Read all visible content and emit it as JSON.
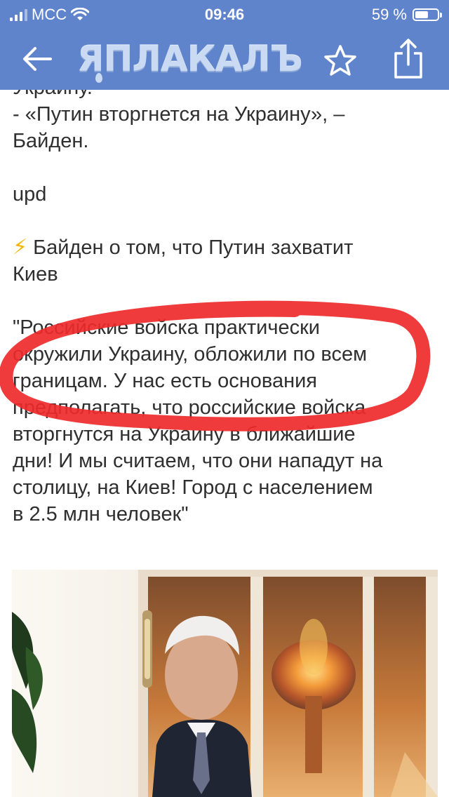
{
  "status_bar": {
    "carrier": "MCC",
    "time": "09:46",
    "battery_percent": "59 %",
    "battery_level": 0.59
  },
  "nav": {
    "logo_text": "ЯПЛАКАЛЪ",
    "back_icon": "arrow-left-icon",
    "star_icon": "star-icon",
    "share_icon": "share-icon",
    "bar_color": "#5f84cb"
  },
  "article": {
    "lines": [
      "Украину.",
      "- «Путин вторгнется на Украину», –",
      "Байден.",
      "",
      "upd",
      "",
      "Байден о том, что Путин захватит",
      "Киев",
      "",
      "\"Российские войска практически",
      "окружили Украину, обложили по всем",
      "границам. У нас есть основания",
      "предполагать, что российские войска",
      "вторгнутся на Украину в ближайшие",
      "дни! И мы считаем, что они нападут на",
      "столицу, на Киев! Город с населением",
      "в 2.5 млн человек\""
    ],
    "bolt_icon": "lightning-icon",
    "highlight_color": "#ee2a2a"
  },
  "photo": {
    "description_icon": "news-photo"
  }
}
